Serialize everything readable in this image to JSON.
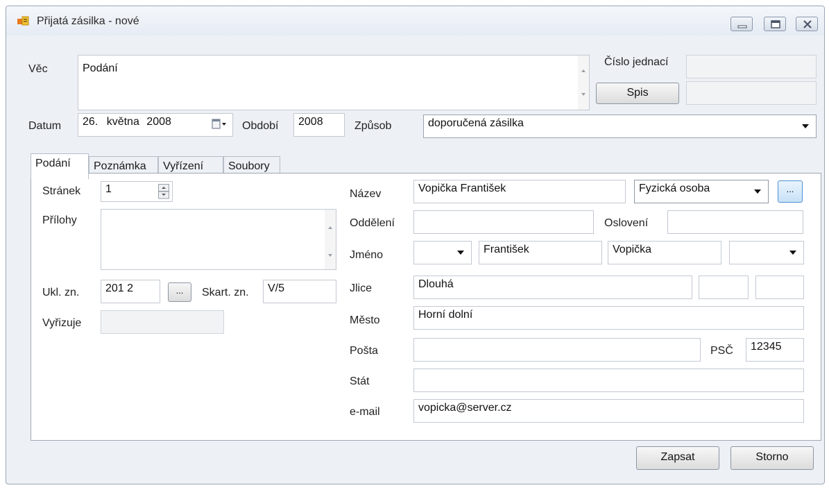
{
  "window": {
    "title": "Přijatá zásilka - nové"
  },
  "header": {
    "vec_label": "Věc",
    "vec_value": "Podání",
    "cislo_jednaci_label": "Číslo jednací",
    "cislo_jednaci_value": "",
    "spis_button": "Spis",
    "spis_value": "",
    "datum_label": "Datum",
    "datum_day": "26.",
    "datum_month": "května",
    "datum_year": "2008",
    "obdobi_label": "Období",
    "obdobi_value": "2008",
    "zpusob_label": "Způsob",
    "zpusob_value": "doporučená zásilka"
  },
  "tabs": [
    {
      "label": "Podání",
      "active": true
    },
    {
      "label": "Poznámka",
      "active": false
    },
    {
      "label": "Vyřízení",
      "active": false
    },
    {
      "label": "Soubory",
      "active": false
    }
  ],
  "left": {
    "stranek_label": "Stránek",
    "stranek_value": "1",
    "prilohy_label": "Přílohy",
    "prilohy_value": "",
    "ukl_label": "Ukl. zn.",
    "ukl_value": "201 2",
    "ukl_browse": "...",
    "skart_label": "Skart. zn.",
    "skart_value": "V/5",
    "vyrizuje_label": "Vyřizuje",
    "vyrizuje_value": ""
  },
  "right": {
    "nazev_label": "Název",
    "nazev_value": "Vopička František",
    "typ_value": "Fyzická osoba",
    "typ_browse": "...",
    "oddeleni_label": "Oddělení",
    "oddeleni_value": "",
    "osloveni_label": "Oslovení",
    "osloveni_value": "",
    "jmeno_label": "Jméno",
    "titul_value": "",
    "jmeno_value": "František",
    "prijmeni_value": "Vopička",
    "titul_za_value": "",
    "ulice_label": "Jlice",
    "ulice_value": "Dlouhá",
    "cislo_popisne": "",
    "cislo_orientacni": "",
    "mesto_label": "Město",
    "mesto_value": "Horní dolní",
    "posta_label": "Pošta",
    "posta_value": "",
    "psc_label": "PSČ",
    "psc_value": "12345",
    "stat_label": "Stát",
    "stat_value": "",
    "email_label": "e-mail",
    "email_value": "vopicka@server.cz"
  },
  "footer": {
    "zapsat_button": "Zapsat",
    "storno_button": "Storno"
  }
}
